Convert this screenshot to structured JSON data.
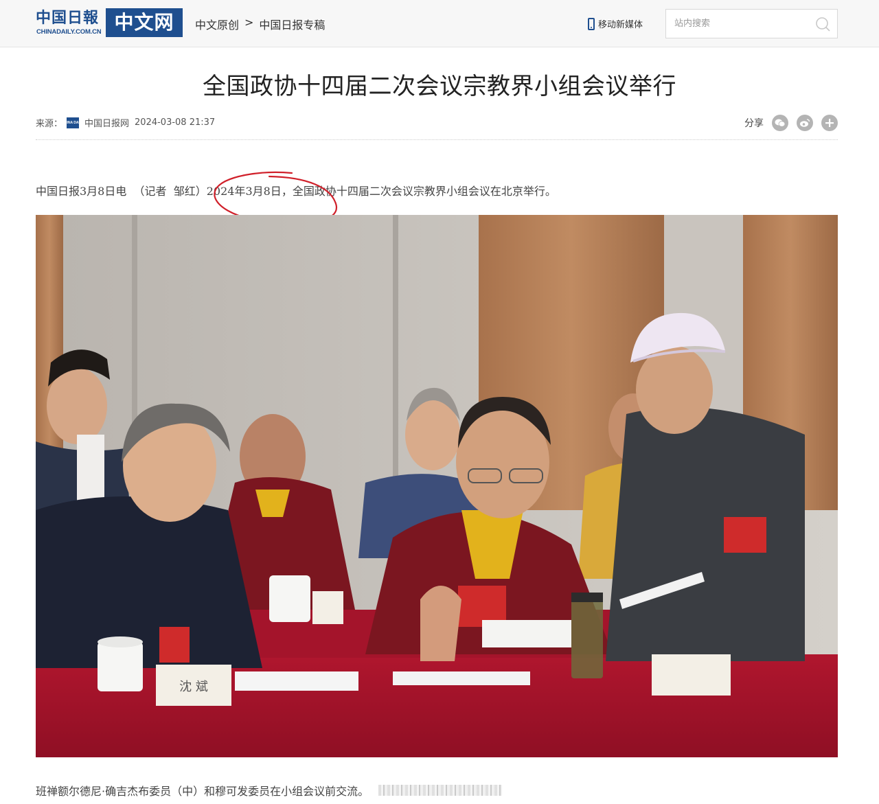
{
  "header": {
    "logo_cn": "中国日報",
    "logo_en": "CHINADAILY.COM.CN",
    "logo_badge": "中文网",
    "breadcrumb": [
      "中文原创",
      "中国日报专稿"
    ],
    "breadcrumb_sep": ">",
    "mobile_label": "移动新媒体",
    "search_placeholder": "站内搜索",
    "icons": {
      "mobile": "phone-icon",
      "search": "search-icon"
    }
  },
  "article": {
    "title": "全国政协十四届二次会议宗教界小组会议举行",
    "source_label": "来源：",
    "source_logo_text": "CHINA DAILY",
    "source_name": "中国日报网",
    "datetime": "2024-03-08 21:37",
    "share_label": "分享",
    "share_icons": [
      "wechat-icon",
      "weibo-icon",
      "more-plus-icon"
    ],
    "lead_prefix": "中国日报3月8日电  （记者  邹红）",
    "lead_date": "2024年3月8日",
    "lead_suffix": "，全国政协十四届二次会议宗教界小组会议在北京举行。",
    "photo_name_card": "沈 斌",
    "caption": "班禅额尔德尼·确吉杰布委员（中）和穆可发委员在小组会议前交流。",
    "annotation_color": "#d0202a"
  },
  "colors": {
    "brand_blue": "#1f4f8f",
    "table_red": "#a3132a",
    "robe_maroon": "#7b1620",
    "robe_yellow": "#e2b21c"
  }
}
